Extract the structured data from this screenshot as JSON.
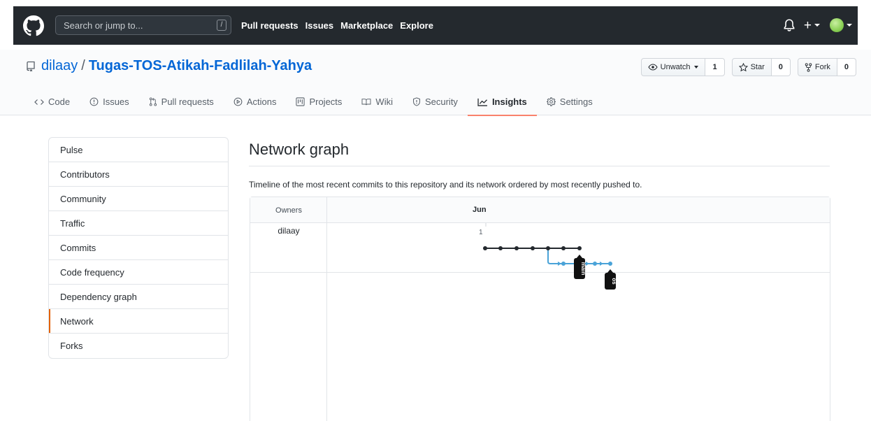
{
  "header": {
    "search_placeholder": "Search or jump to...",
    "search_key": "/",
    "nav": [
      "Pull requests",
      "Issues",
      "Marketplace",
      "Explore"
    ],
    "plus": "+"
  },
  "repo": {
    "owner": "dilaay",
    "separator": "/",
    "name": "Tugas-TOS-Atikah-Fadlilah-Yahya",
    "watch_label": "Unwatch",
    "watch_count": "1",
    "star_label": "Star",
    "star_count": "0",
    "fork_label": "Fork",
    "fork_count": "0"
  },
  "tabs": [
    {
      "label": "Code",
      "icon": "code-icon"
    },
    {
      "label": "Issues",
      "icon": "issue-icon"
    },
    {
      "label": "Pull requests",
      "icon": "pull-request-icon"
    },
    {
      "label": "Actions",
      "icon": "play-icon"
    },
    {
      "label": "Projects",
      "icon": "project-icon"
    },
    {
      "label": "Wiki",
      "icon": "book-icon"
    },
    {
      "label": "Security",
      "icon": "shield-icon"
    },
    {
      "label": "Insights",
      "icon": "graph-icon",
      "selected": true
    },
    {
      "label": "Settings",
      "icon": "gear-icon"
    }
  ],
  "menu": [
    "Pulse",
    "Contributors",
    "Community",
    "Traffic",
    "Commits",
    "Code frequency",
    "Dependency graph",
    "Network",
    "Forks"
  ],
  "menu_selected": "Network",
  "main": {
    "title": "Network graph",
    "description": "Timeline of the most recent commits to this repository and its network ordered by most recently pushed to."
  },
  "graph": {
    "owners_header": "Owners",
    "month": "Jun",
    "day": "1",
    "owner": "dilaay",
    "branches": [
      {
        "label": "main",
        "color": "#24292e",
        "commits": 7
      },
      {
        "label": "os",
        "color": "#4aa3d8",
        "commits": 5
      }
    ]
  },
  "colors": {
    "header_bg": "#24292e",
    "link": "#0366d6",
    "selected_tab_underline": "#f9826c",
    "branch_main": "#24292e",
    "branch_os": "#4aa3d8"
  }
}
